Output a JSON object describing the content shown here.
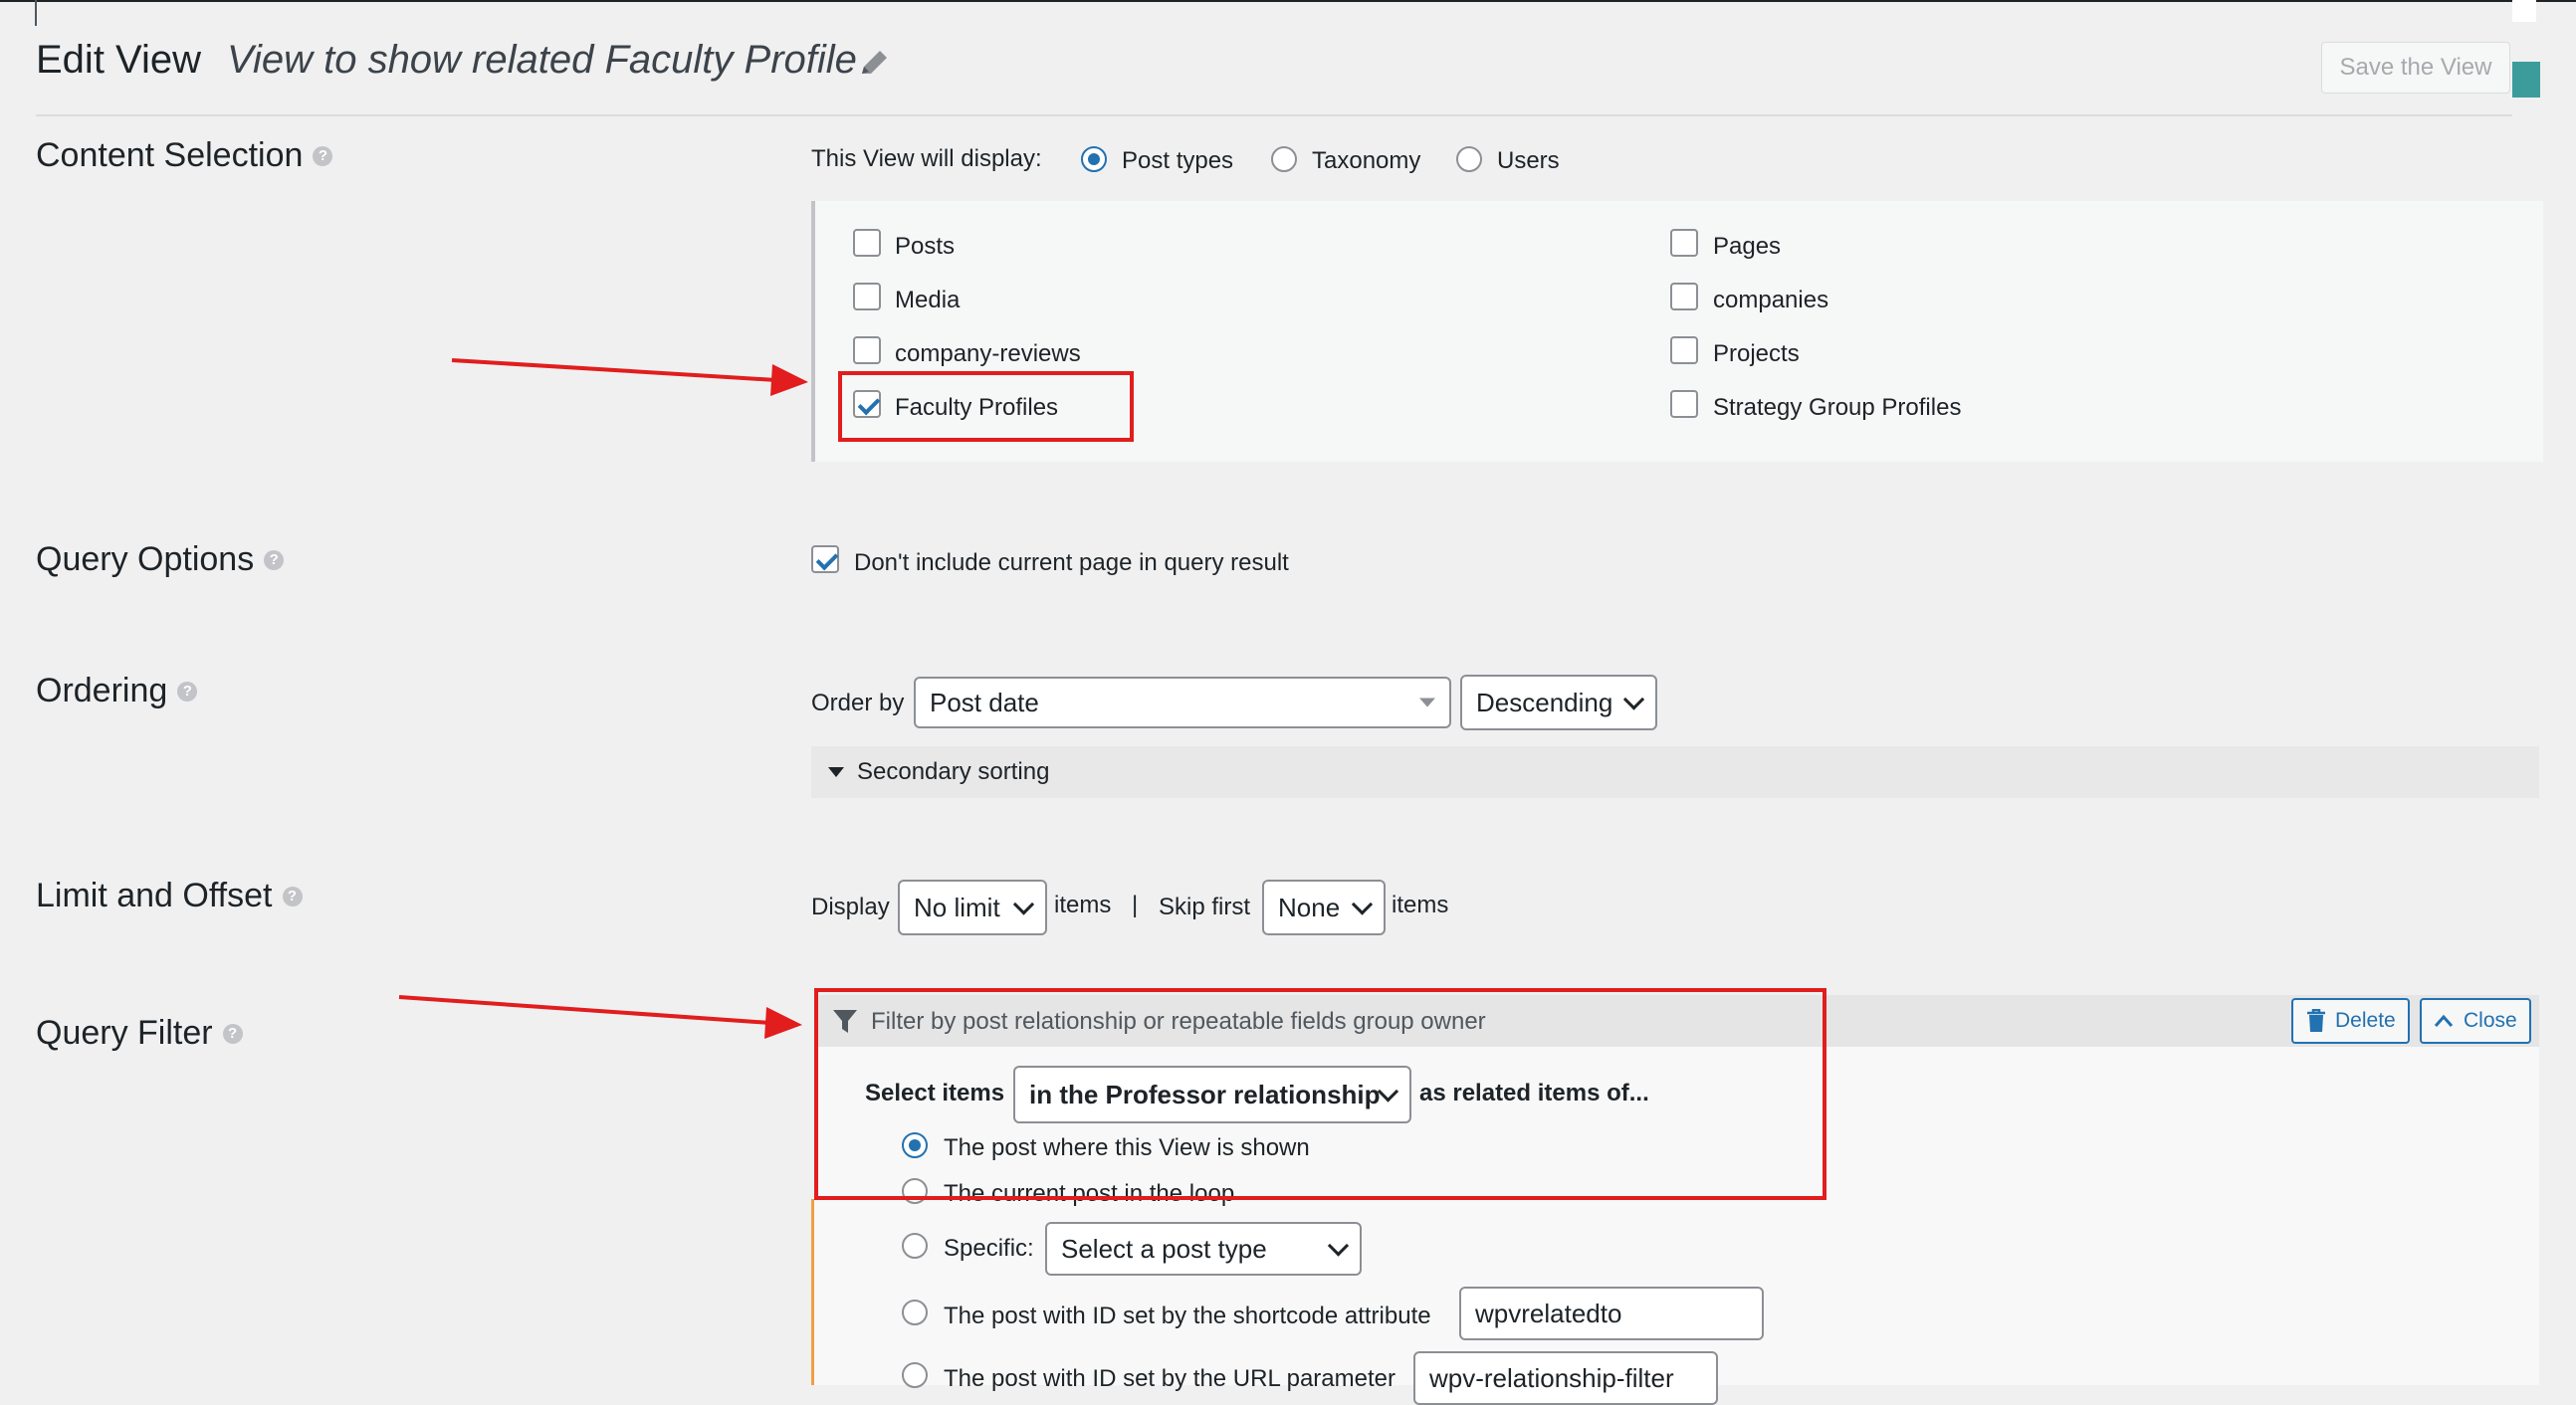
{
  "header": {
    "title": "Edit View",
    "view_name": "View to show related Faculty Profile",
    "save_label": "Save the View"
  },
  "content_selection": {
    "label": "Content Selection",
    "display_label": "This View will display:",
    "display_options": [
      "Post types",
      "Taxonomy",
      "Users"
    ],
    "selected_display": "Post types",
    "post_types_left": [
      {
        "label": "Posts",
        "checked": false
      },
      {
        "label": "Media",
        "checked": false
      },
      {
        "label": "company-reviews",
        "checked": false
      },
      {
        "label": "Faculty Profiles",
        "checked": true
      }
    ],
    "post_types_right": [
      {
        "label": "Pages",
        "checked": false
      },
      {
        "label": "companies",
        "checked": false
      },
      {
        "label": "Projects",
        "checked": false
      },
      {
        "label": "Strategy Group Profiles",
        "checked": false
      }
    ]
  },
  "query_options": {
    "label": "Query Options",
    "exclude_current_label": "Don't include current page in query result",
    "exclude_current_checked": true
  },
  "ordering": {
    "label": "Ordering",
    "order_by_label": "Order by",
    "order_by_value": "Post date",
    "direction_value": "Descending",
    "secondary_sorting_label": "Secondary sorting"
  },
  "limit_offset": {
    "label": "Limit and Offset",
    "display_label": "Display",
    "limit_value": "No limit",
    "items_label": "items",
    "separator": "|",
    "skip_label": "Skip first",
    "skip_value": "None",
    "items_label_2": "items"
  },
  "query_filter": {
    "label": "Query Filter",
    "header_text": "Filter by post relationship or repeatable fields group owner",
    "delete_label": "Delete",
    "close_label": "Close",
    "select_items_label": "Select items",
    "relationship_value": "in the Professor relationship",
    "as_related_label": "as related items of...",
    "options": {
      "post_where_shown": "The post where this View is shown",
      "current_post_loop": "The current post in the loop",
      "specific_label": "Specific:",
      "specific_select": "Select a post type",
      "shortcode_attr_label": "The post with ID set by the shortcode attribute",
      "shortcode_attr_value": "wpvrelatedto",
      "url_param_label": "The post with ID set by the URL parameter",
      "url_param_value": "wpv-relationship-filter"
    },
    "selected_option": "post_where_shown"
  },
  "colors": {
    "accent": "#2271b1",
    "annotation_red": "#e11d1d",
    "teal": "#3c9c9c",
    "orange": "#f0a043"
  }
}
